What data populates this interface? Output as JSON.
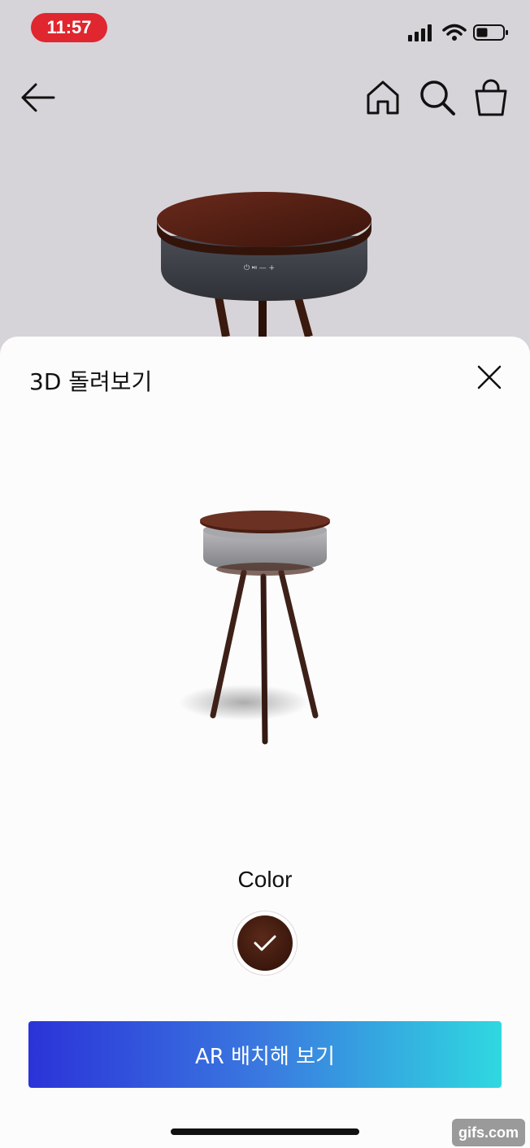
{
  "status_bar": {
    "time": "11:57",
    "icons": [
      "signal-icon",
      "wifi-icon",
      "battery-icon"
    ]
  },
  "nav": {
    "icons": [
      "back-arrow-icon",
      "home-icon",
      "search-icon",
      "shopping-bag-icon"
    ]
  },
  "sheet": {
    "title": "3D 돌려보기",
    "close_icon": "close-icon",
    "color_label": "Color",
    "selected_color": "#3a170c",
    "ar_button_label": "AR 배치해 보기"
  },
  "watermark": "gifs.com",
  "colors": {
    "time_pill": "#e0262f",
    "button_gradient_start": "#2b33d8",
    "button_gradient_end": "#2fd8e0",
    "table_wood": "#4a1d12",
    "speaker_fabric": "#5b5f67"
  }
}
